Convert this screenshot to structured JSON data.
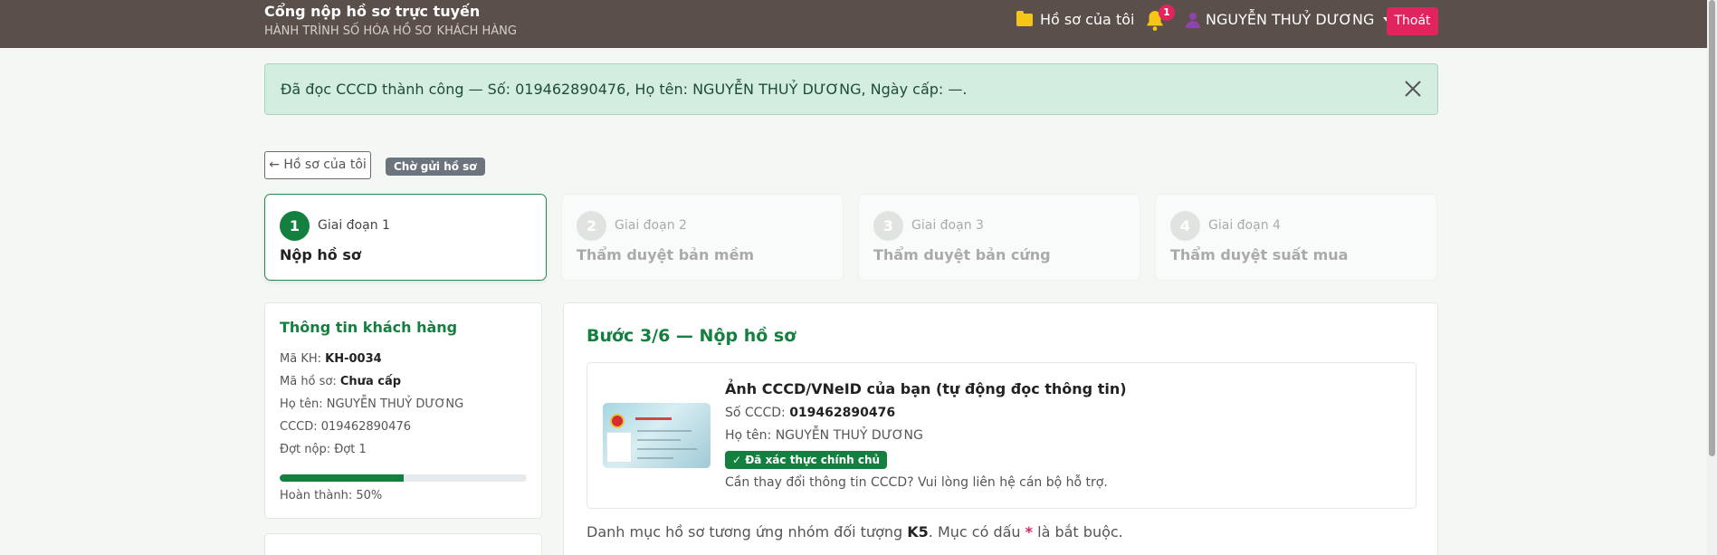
{
  "header": {
    "title": "Cổng nộp hồ sơ trực tuyến",
    "subtitle": "HÀNH TRÌNH SỐ HÓA HỒ SƠ KHÁCH HÀNG",
    "my_files": "Hồ sơ của tôi",
    "notification_count": "1",
    "user_name": "NGUYỄN THUỶ DƯƠNG",
    "logout": "Thoát"
  },
  "alert": {
    "message": "Đã đọc CCCD thành công — Số: 019462890476, Họ tên: NGUYỄN THUỶ DƯƠNG, Ngày cấp: —."
  },
  "nav": {
    "back": "← Hồ sơ của tôi",
    "status": "Chờ gửi hồ sơ"
  },
  "stages": [
    {
      "num": "1",
      "label": "Giai đoạn 1",
      "title": "Nộp hồ sơ",
      "active": true
    },
    {
      "num": "2",
      "label": "Giai đoạn 2",
      "title": "Thẩm duyệt bản mềm",
      "active": false
    },
    {
      "num": "3",
      "label": "Giai đoạn 3",
      "title": "Thẩm duyệt bản cứng",
      "active": false
    },
    {
      "num": "4",
      "label": "Giai đoạn 4",
      "title": "Thẩm duyệt suất mua",
      "active": false
    }
  ],
  "customer": {
    "title": "Thông tin khách hàng",
    "code_label": "Mã KH:",
    "code": "KH-0034",
    "file_label": "Mã hồ sơ:",
    "file": "Chưa cấp",
    "name_label": "Họ tên:",
    "name": "NGUYỄN THUỶ DƯƠNG",
    "cccd_label": "CCCD:",
    "cccd": "019462890476",
    "batch_label": "Đợt nộp:",
    "batch": "Đợt 1",
    "progress": 0.5,
    "progress_text": "Hoàn thành: 50%"
  },
  "main": {
    "title": "Bước 3/6 — Nộp hồ sơ",
    "id_heading": "Ảnh CCCD/VNeID của bạn (tự động đọc thông tin)",
    "id_number_label": "Số CCCD:",
    "id_number": "019462890476",
    "id_name_label": "Họ tên:",
    "id_name": "NGUYỄN THUỶ DƯƠNG",
    "verified": "✓ Đã xác thực chính chủ",
    "note": "Cần thay đổi thông tin CCCD? Vui lòng liên hệ cán bộ hỗ trợ.",
    "category_prefix": "Danh mục hồ sơ tương ứng nhóm đối tượng",
    "category_code": "K5",
    "category_mid": ". Mục có dấu",
    "required_mark": "*",
    "category_suffix": "là bắt buộc."
  },
  "colors": {
    "topbar": "#5a4f4a",
    "accent_green": "#14803f",
    "danger": "#e0245e",
    "alert_bg": "#d4ede1"
  }
}
